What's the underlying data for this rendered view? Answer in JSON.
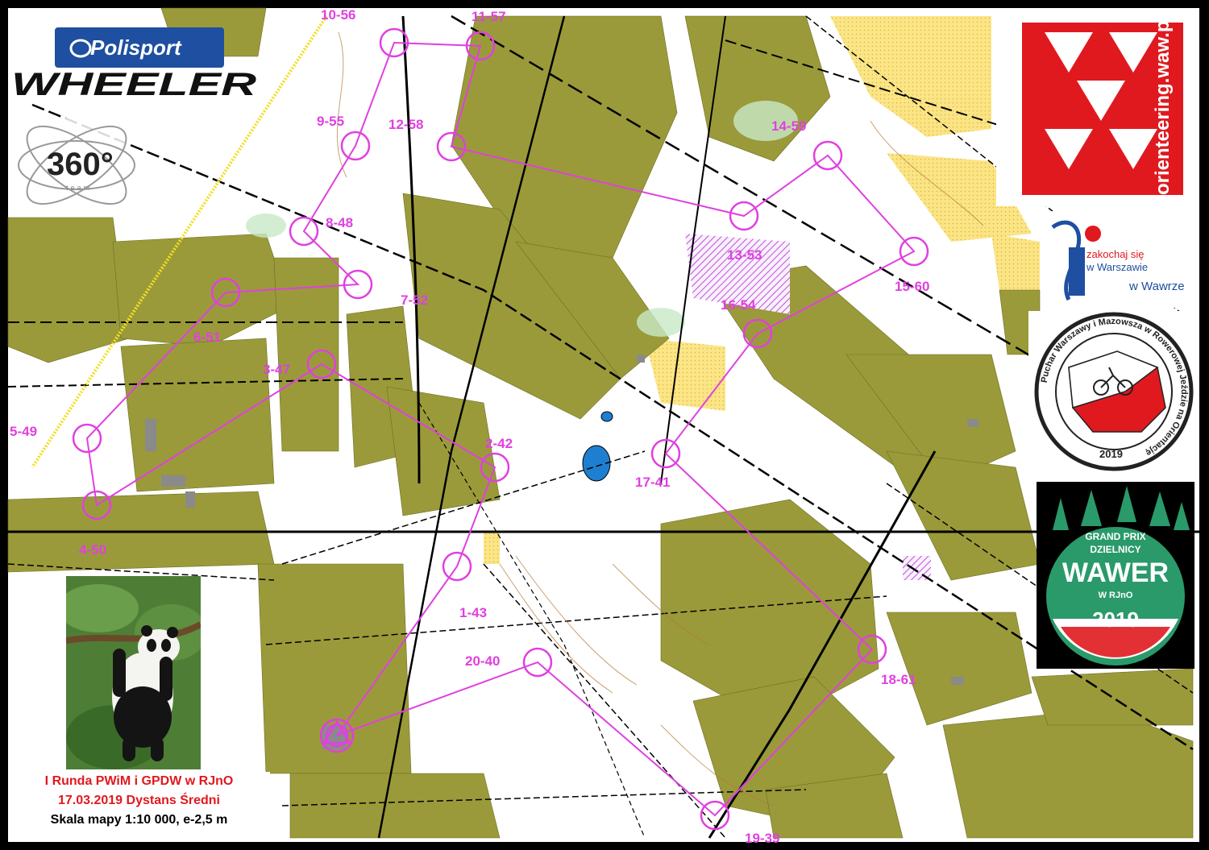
{
  "logos": {
    "polisport": "Polisport",
    "wheeler": "WHEELER",
    "team360": "360°",
    "team360_sub": "team",
    "orienteering": "orienteering.waw.pl",
    "zakochaj_line1": "zakochaj się",
    "zakochaj_line2": "w Warszawie",
    "zakochaj_line3": "w Wawrze",
    "puchar_ring": "Puchar Warszawy i Mazowsza w Rowerowej Jeździe na Orientację",
    "puchar_year": "2019",
    "gp_line1": "GRAND PRIX",
    "gp_line2": "DZIELNICY",
    "gp_line3": "WAWER",
    "gp_line4": "W RJnO",
    "gp_year": "2019"
  },
  "caption": {
    "line1": "I Runda PWiM i GPDW w RJnO",
    "line2": "17.03.2019 Dystans Średni",
    "line3": "Skala mapy 1:10 000, e-2,5 m"
  },
  "controls": [
    {
      "label": "1-43"
    },
    {
      "label": "2-42"
    },
    {
      "label": "3-47"
    },
    {
      "label": "4-50"
    },
    {
      "label": "5-49"
    },
    {
      "label": "6-51"
    },
    {
      "label": "7-52"
    },
    {
      "label": "8-48"
    },
    {
      "label": "9-55"
    },
    {
      "label": "10-56"
    },
    {
      "label": "11-57"
    },
    {
      "label": "12-58"
    },
    {
      "label": "13-53"
    },
    {
      "label": "14-59"
    },
    {
      "label": "15-60"
    },
    {
      "label": "16-54"
    },
    {
      "label": "17-41"
    },
    {
      "label": "18-61"
    },
    {
      "label": "19-39"
    },
    {
      "label": "20-40"
    }
  ],
  "colors": {
    "course": "#e040e0",
    "forest": "#9a9a3a",
    "paper": "#ffffff",
    "red": "#e0191f",
    "gp_green": "#2a9a6a"
  }
}
